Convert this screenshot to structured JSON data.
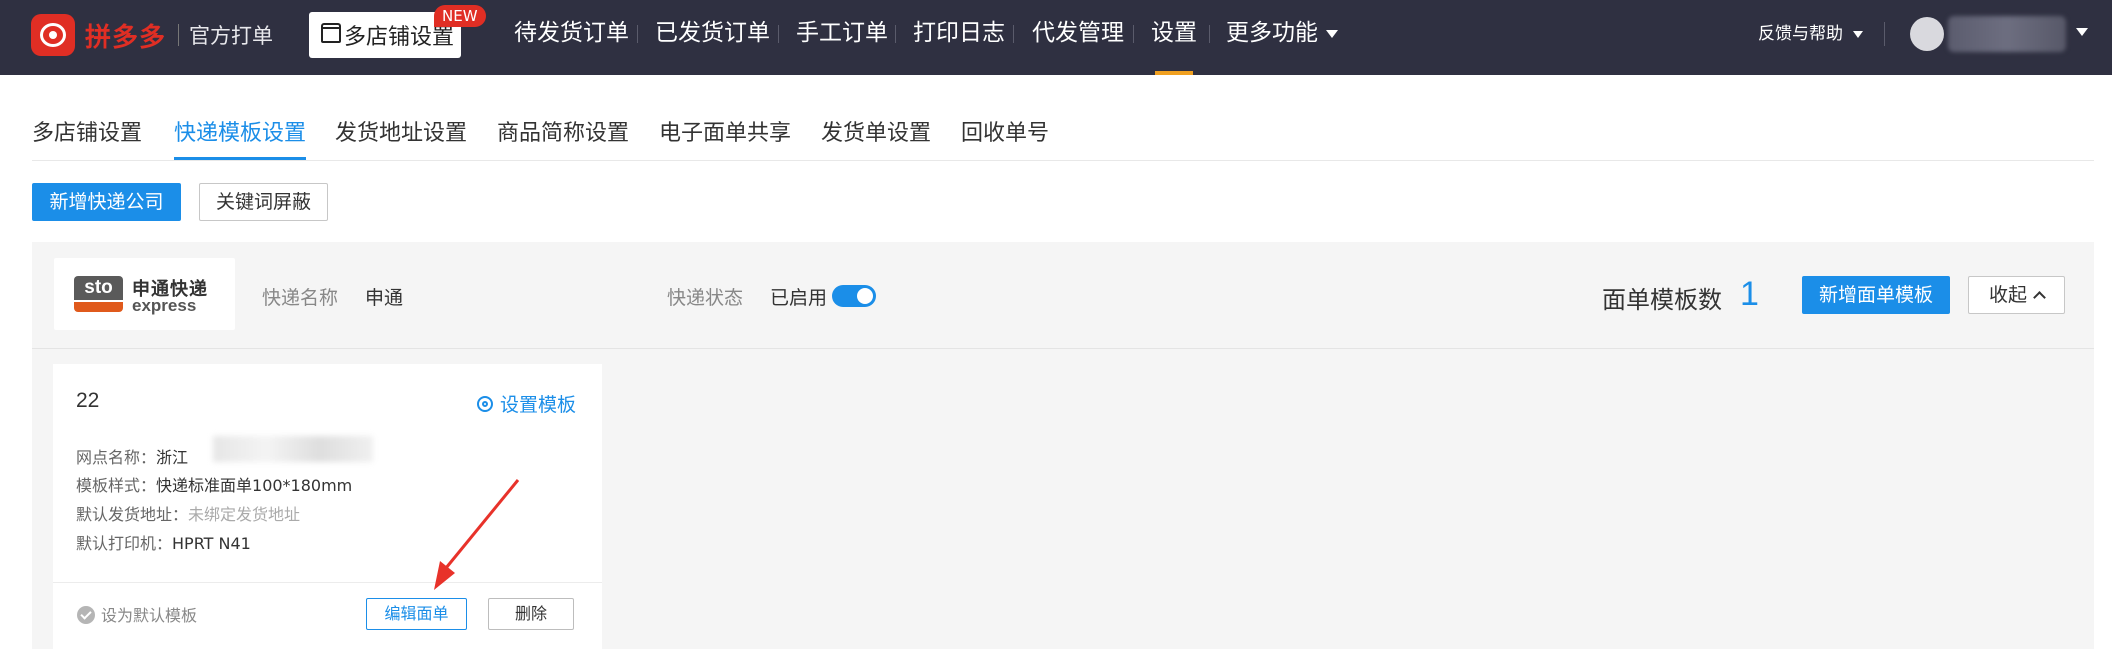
{
  "brand": {
    "name": "拼多多",
    "subtitle": "官方打单"
  },
  "top_nav": {
    "store_settings": "多店铺设置",
    "new_badge": "NEW",
    "items": [
      "待发货订单",
      "已发货订单",
      "手工订单",
      "打印日志",
      "代发管理",
      "设置",
      "更多功能"
    ],
    "active_index": 5,
    "help": "反馈与帮助"
  },
  "sub_tabs": {
    "items": [
      "多店铺设置",
      "快递模板设置",
      "发货地址设置",
      "商品简称设置",
      "电子面单共享",
      "发货单设置",
      "回收单号"
    ],
    "active_index": 1
  },
  "actions": {
    "add_express": "新增快递公司",
    "keyword_block": "关键词屏蔽"
  },
  "express": {
    "logo_cn": "申通快递",
    "logo_en": "express",
    "logo_mark": "sto",
    "name_label": "快递名称",
    "name_value": "申通",
    "status_label": "快递状态",
    "status_value": "已启用",
    "enabled": true,
    "template_count_label": "面单模板数",
    "template_count": "1",
    "add_template": "新增面单模板",
    "collapse": "收起"
  },
  "template_card": {
    "title": "22",
    "set_template": "设置模板",
    "branch_label": "网点名称：",
    "branch_value": "浙江",
    "style_label": "模板样式：",
    "style_value": "快递标准面单100*180mm",
    "address_label": "默认发货地址：",
    "address_value": "未绑定发货地址",
    "printer_label": "默认打印机：",
    "printer_value": "HPRT N41",
    "set_default": "设为默认模板",
    "edit": "编辑面单",
    "delete": "删除"
  },
  "colors": {
    "accent": "#1b8ee8",
    "brand_red": "#e02e24",
    "topbar": "#2f3041",
    "active_underline": "#f0a020",
    "annotation_arrow": "#e8322a"
  }
}
